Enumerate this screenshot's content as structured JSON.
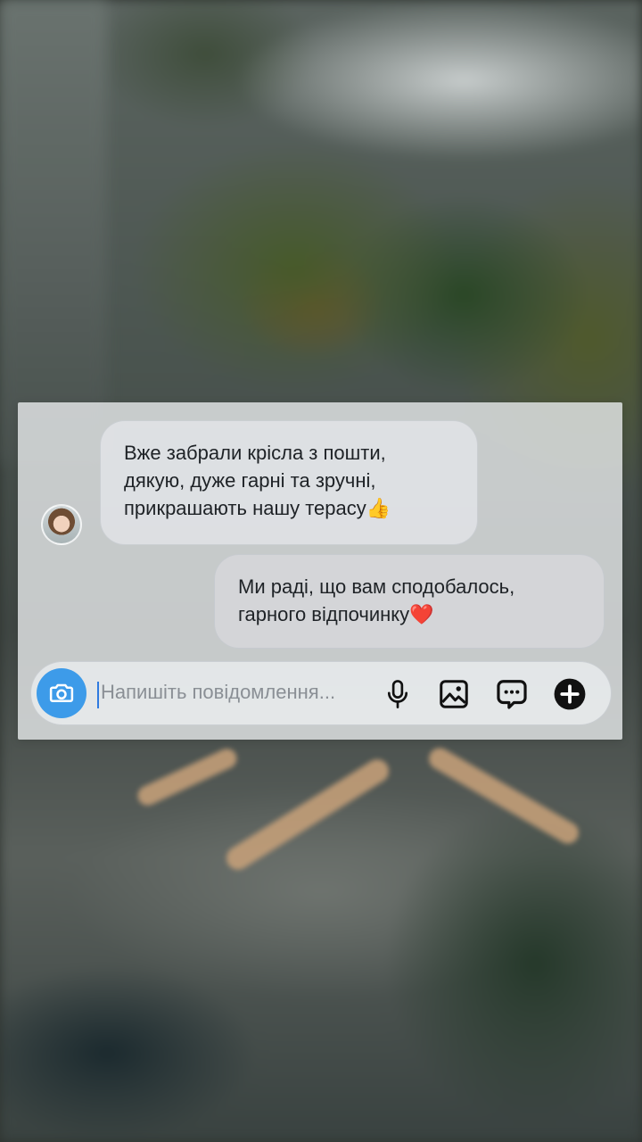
{
  "messages": [
    {
      "direction": "incoming",
      "lines": [
        "Вже забрали крісла з пошти,",
        "дякую, дуже гарні та зручні,",
        "прикрашають нашу терасу👍"
      ]
    },
    {
      "direction": "outgoing",
      "lines": [
        "Ми раді, що вам сподобалось,",
        "гарного відпочинку❤️"
      ]
    }
  ],
  "composer": {
    "placeholder": "Напишіть повідомлення...",
    "buttons": {
      "camera": "camera-icon",
      "mic": "microphone-icon",
      "gallery": "image-icon",
      "sticker": "chat-bubble-dots-icon",
      "plus": "plus-circle-icon"
    }
  },
  "colors": {
    "camera_button": "#3d9be9",
    "text": "#1e2226",
    "placeholder": "#8a8f95",
    "cursor": "#2f7be0"
  }
}
